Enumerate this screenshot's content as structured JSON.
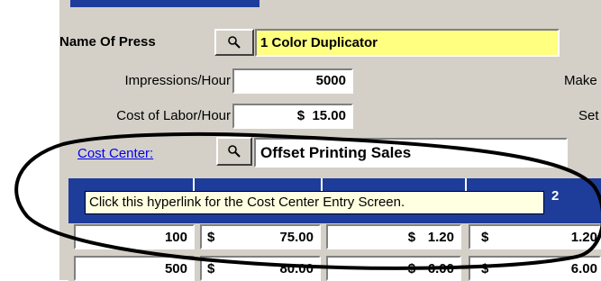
{
  "form": {
    "press_label": "Name Of Press",
    "press_value": "1 Color Duplicator",
    "impressions_label": "Impressions/Hour",
    "impressions_value": "5000",
    "make_label": "Make",
    "labor_label": "Cost of Labor/Hour",
    "labor_currency": "$",
    "labor_value": "15.00",
    "set_label": "Set",
    "cost_center_label": "Cost Center:",
    "cost_center_value": "Offset Printing Sales"
  },
  "tooltip": "Click this hyperlink for the Cost Center Entry Screen.",
  "grid": {
    "header_partial": "2",
    "rows": [
      {
        "qty": "100",
        "c1": "$",
        "v1": "75.00",
        "c2": "$",
        "v2": "1.20",
        "c3": "$",
        "v3": "1.20"
      },
      {
        "qty": "500",
        "c1": "$",
        "v1": "80.00",
        "c2": "$",
        "v2": "6.00",
        "c3": "$",
        "v3": "6.00"
      }
    ]
  },
  "colors": {
    "field_highlight": "#ffff80",
    "header_blue": "#1e3c9a",
    "link": "#0000ee"
  },
  "icons": {
    "lookup": "magnifier-icon"
  }
}
